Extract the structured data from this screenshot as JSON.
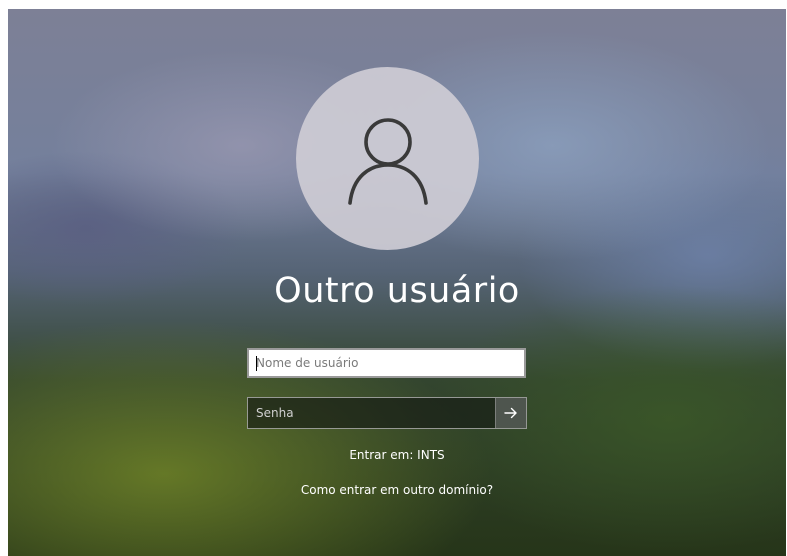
{
  "login": {
    "title": "Outro usuário",
    "username_placeholder": "Nome de usuário",
    "username_value": "",
    "password_placeholder": "Senha",
    "password_value": "",
    "submit_icon": "arrow-right-icon",
    "avatar_icon": "user-icon",
    "domain_text": "Entrar em: INTS",
    "other_domain_link": "Como entrar em outro domínio?"
  },
  "colors": {
    "avatar_bg": "#cdcbd4",
    "avatar_glyph": "#3a3a3a",
    "text": "#ffffff",
    "input_bg": "#ffffff",
    "password_field_bg": "#14181a"
  }
}
